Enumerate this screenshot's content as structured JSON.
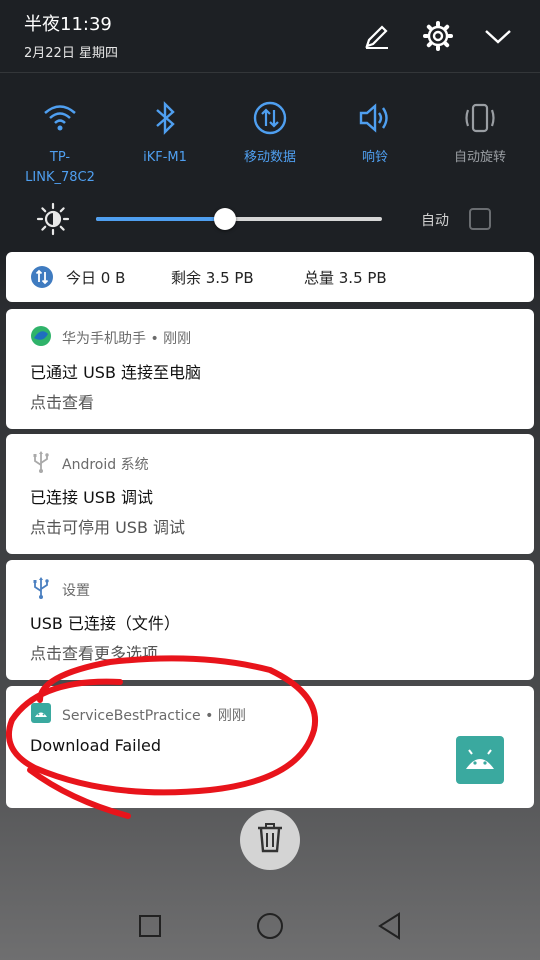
{
  "status": {
    "time": "半夜11:39",
    "date": "2月22日 星期四"
  },
  "header_icons": [
    "edit-icon",
    "settings-gear-icon",
    "collapse-chevron-icon"
  ],
  "quick_settings": [
    {
      "label": "TP-\nLINK_78C2",
      "icon": "wifi-icon",
      "active": true
    },
    {
      "label": "iKF-M1",
      "icon": "bluetooth-icon",
      "active": true
    },
    {
      "label": "移动数据",
      "icon": "mobile-data-icon",
      "active": true
    },
    {
      "label": "响铃",
      "icon": "ringer-icon",
      "active": true
    },
    {
      "label": "自动旋转",
      "icon": "auto-rotate-icon",
      "active": false
    }
  ],
  "brightness": {
    "level": 0.45,
    "auto_label": "自动",
    "auto_checked": false
  },
  "data_usage": {
    "today": "今日 0 B",
    "remaining": "剩余 3.5 PB",
    "total": "总量 3.5 PB"
  },
  "notifications": [
    {
      "app": "华为手机助手 • 刚刚",
      "title": "已通过 USB 连接至电脑",
      "text": "点击查看",
      "icon": "huawei-assistant-icon"
    },
    {
      "app": "Android 系统",
      "title": "已连接 USB 调试",
      "text": "点击可停用 USB 调试",
      "icon": "usb-icon"
    },
    {
      "app": "设置",
      "title": "USB 已连接（文件）",
      "text": "点击查看更多选项",
      "icon": "usb-icon"
    },
    {
      "app": "ServiceBestPractice • 刚刚",
      "title": "Download Failed",
      "text": "",
      "icon": "android-app-icon"
    }
  ],
  "colors": {
    "accent": "#4f9ff0",
    "annotation": "#e8141b",
    "app_icon": "#3aa99f"
  }
}
